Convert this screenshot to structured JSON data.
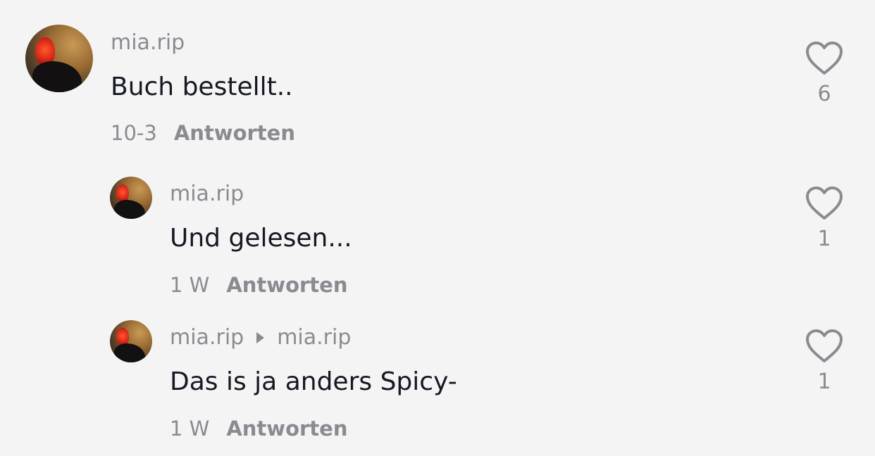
{
  "comments": [
    {
      "username": "mia.rip",
      "text": "Buch bestellt..",
      "date": "10-3",
      "reply_label": "Antworten",
      "likes": "6"
    },
    {
      "username": "mia.rip",
      "text": "Und gelesen...",
      "date": "1 W",
      "reply_label": "Antworten",
      "likes": "1"
    },
    {
      "username": "mia.rip",
      "reply_to": "mia.rip",
      "text": "Das is ja anders Spicy-",
      "date": "1 W",
      "reply_label": "Antworten",
      "likes": "1"
    }
  ]
}
